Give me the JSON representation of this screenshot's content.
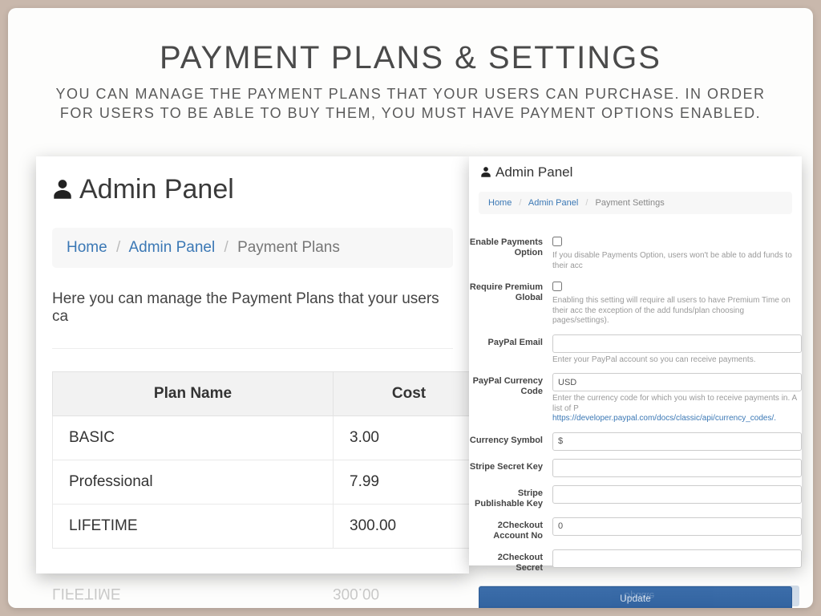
{
  "hero": {
    "title": "PAYMENT PLANS & SETTINGS",
    "subtitle": "YOU CAN MANAGE THE PAYMENT PLANS THAT YOUR USERS CAN PURCHASE. IN ORDER FOR USERS TO BE ABLE TO BUY THEM, YOU MUST HAVE PAYMENT OPTIONS ENABLED."
  },
  "left": {
    "panel_title": "Admin Panel",
    "breadcrumb": {
      "home": "Home",
      "admin": "Admin Panel",
      "current": "Payment Plans"
    },
    "intro": "Here you can manage the Payment Plans that your users ca",
    "table": {
      "cols": {
        "name": "Plan Name",
        "cost": "Cost"
      },
      "rows": [
        {
          "name": "BASIC",
          "cost": "3.00"
        },
        {
          "name": "Professional",
          "cost": "7.99"
        },
        {
          "name": "LIFETIME",
          "cost": "300.00"
        }
      ]
    }
  },
  "right": {
    "panel_title": "Admin Panel",
    "breadcrumb": {
      "home": "Home",
      "admin": "Admin Panel",
      "current": "Payment Settings"
    },
    "fields": {
      "enable_payments": {
        "label": "Enable Payments Option",
        "help": "If you disable Payments Option, users won't be able to add funds to their acc"
      },
      "require_premium": {
        "label": "Require Premium Global",
        "help": "Enabling this setting will require all users to have Premium Time on their acc the exception of the add funds/plan choosing pages/settings)."
      },
      "paypal_email": {
        "label": "PayPal Email",
        "value": "",
        "help": "Enter your PayPal account so you can receive payments."
      },
      "paypal_currency": {
        "label": "PayPal Currency Code",
        "value": "USD",
        "help_pre": "Enter the currency code for which you wish to receive payments in. A list of P",
        "help_link": "https://developer.paypal.com/docs/classic/api/currency_codes/."
      },
      "currency_symbol": {
        "label": "Currency Symbol",
        "value": "$"
      },
      "stripe_secret": {
        "label": "Stripe Secret Key",
        "value": ""
      },
      "stripe_publishable": {
        "label": "Stripe Publishable Key",
        "value": ""
      },
      "twocheckout_account": {
        "label": "2Checkout Account No",
        "value": "0"
      },
      "twocheckout_secret": {
        "label": "2Checkout Secret",
        "value": ""
      }
    },
    "update_label": "Update"
  }
}
